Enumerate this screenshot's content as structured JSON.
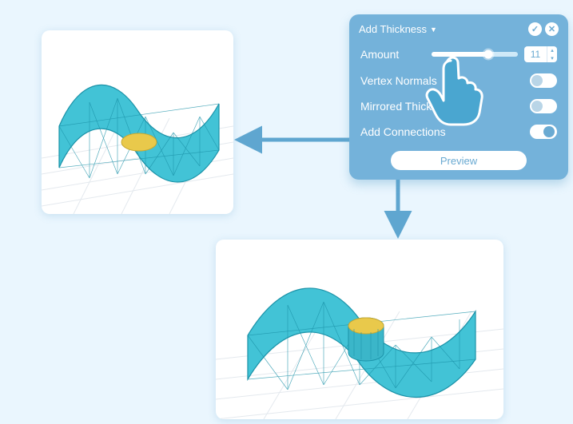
{
  "panel": {
    "title": "Add Thickness",
    "rows": {
      "amount_label": "Amount",
      "amount_value": "11",
      "vertex_normals_label": "Vertex Normals",
      "vertex_normals_on": false,
      "mirrored_label": "Mirrored Thickness",
      "mirrored_on": false,
      "add_conn_label": "Add Connections",
      "add_conn_on": true
    },
    "preview_label": "Preview"
  },
  "icons": {
    "confirm": "✓",
    "cancel": "✕",
    "dropdown": "▼",
    "up": "▴",
    "down": "▾"
  },
  "colors": {
    "panel": "#74b2da",
    "mesh_fill": "#42c3d6",
    "mesh_stroke": "#1b92a8",
    "spot": "#e9c94b",
    "arrow": "#5fa6d0",
    "hand": "#4aa6d0"
  }
}
